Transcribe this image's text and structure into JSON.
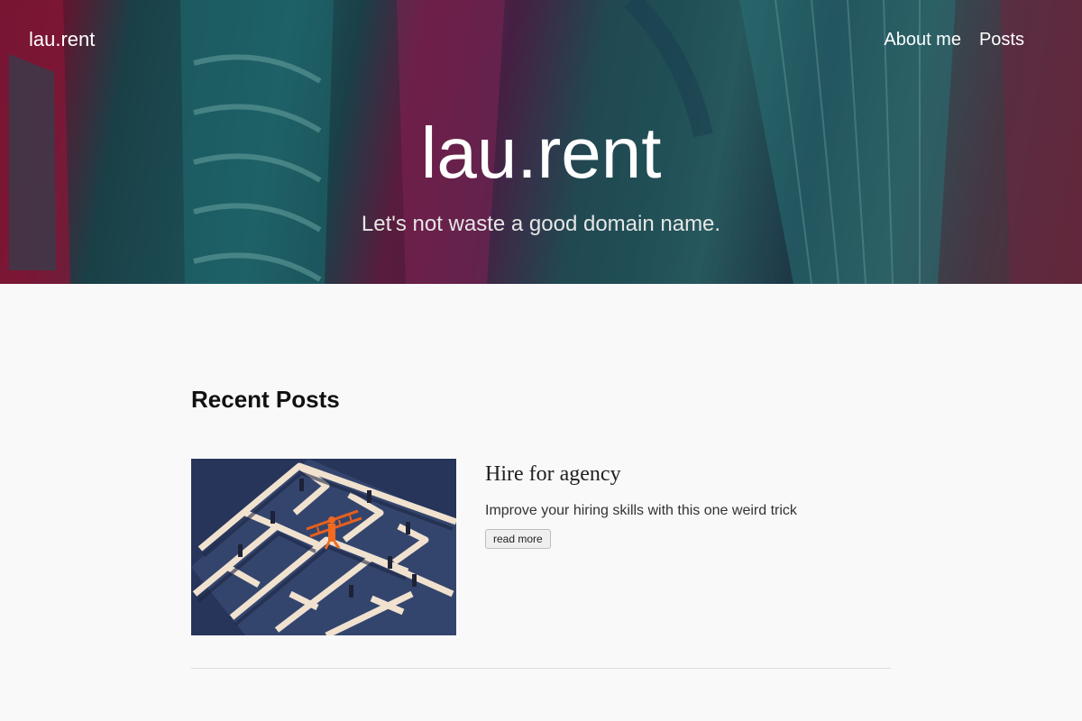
{
  "header": {
    "brand": "lau.rent",
    "nav": [
      {
        "label": "About me"
      },
      {
        "label": "Posts"
      }
    ],
    "title": "lau.rent",
    "subtitle": "Let's not waste a good domain name."
  },
  "main": {
    "section_title": "Recent Posts",
    "posts": [
      {
        "title": "Hire for agency",
        "description": "Improve your hiring skills with this one weird trick",
        "read_more": "read more"
      }
    ]
  },
  "colors": {
    "page_background": "#f9f9f9",
    "hero_text": "#ffffff",
    "thumb_background": "#27355a",
    "thumb_walls": "#f1e2cf",
    "accent_figure": "#e8601c"
  }
}
